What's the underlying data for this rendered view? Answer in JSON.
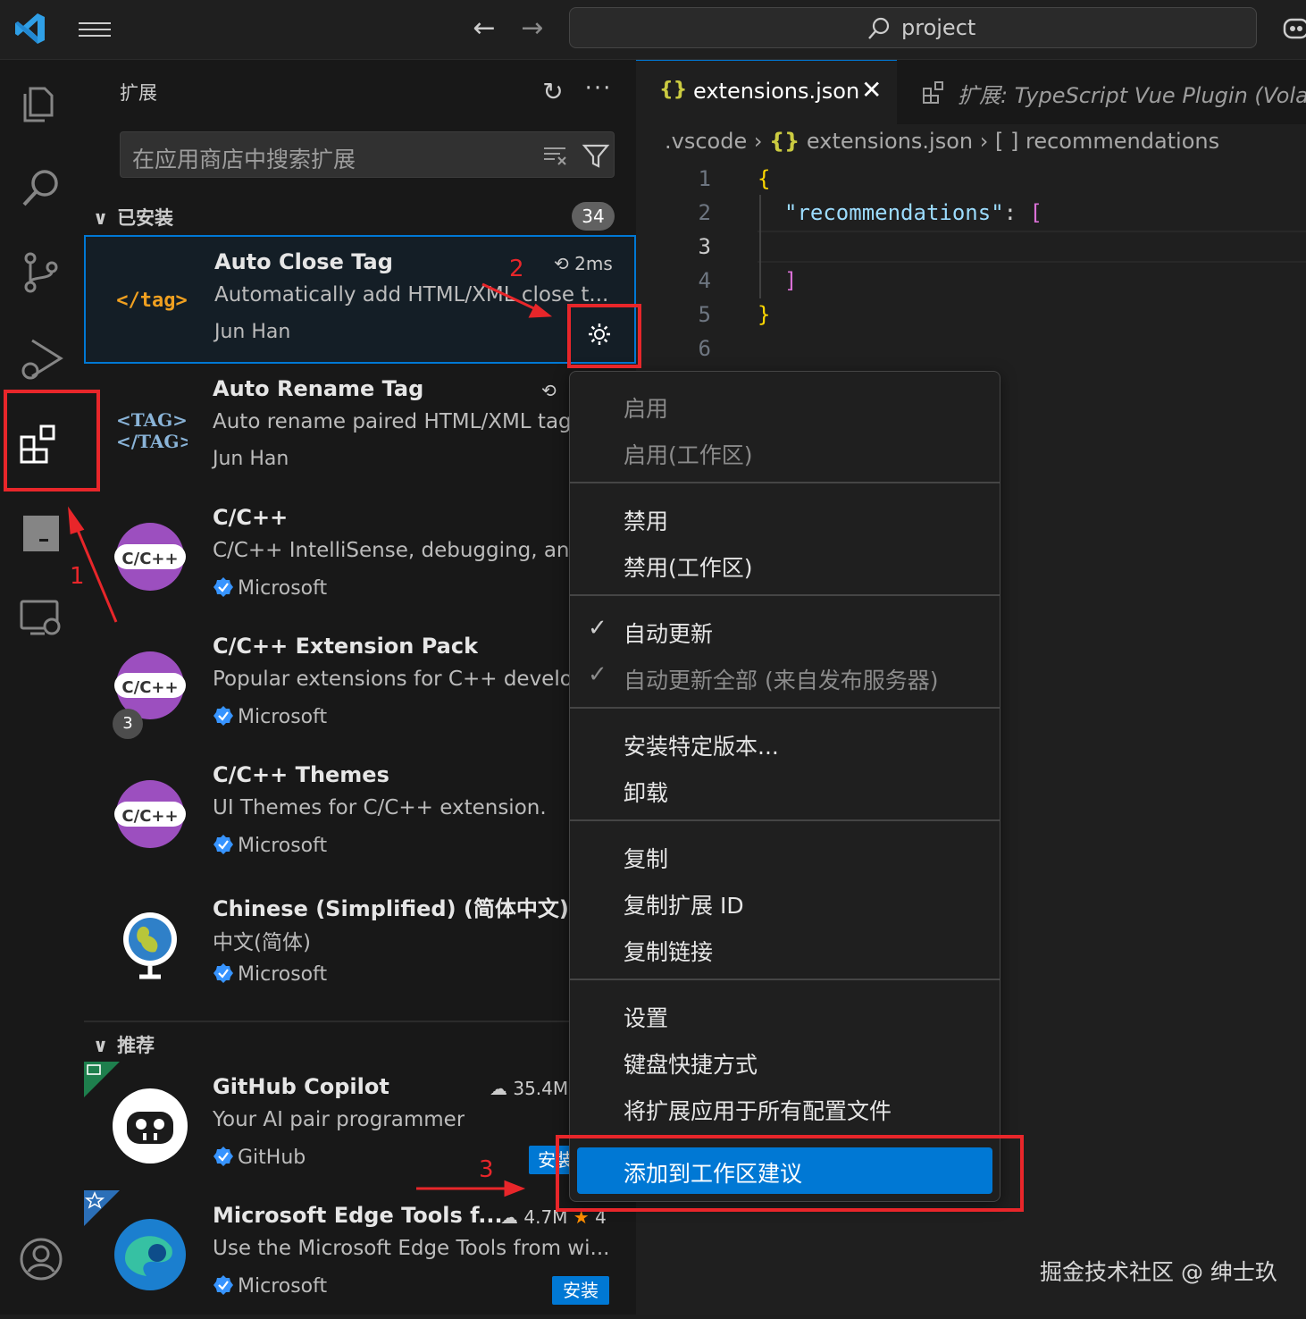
{
  "titlebar": {
    "search_text": "project",
    "icons": [
      "vscode-logo",
      "menu-icon",
      "arrow-left-icon",
      "arrow-right-icon",
      "search-icon",
      "copilot-icon"
    ]
  },
  "activity_bar": {
    "items": [
      "explorer-icon",
      "search-icon",
      "source-control-icon",
      "run-debug-icon",
      "extensions-icon",
      "panel-icon",
      "remote-explorer-icon",
      "account-icon"
    ]
  },
  "sidebar": {
    "title": "扩展",
    "search_placeholder": "在应用商店中搜索扩展",
    "installed_label": "已安装",
    "installed_count": "34",
    "recommended_label": "推荐",
    "installed": [
      {
        "name": "Auto Close Tag",
        "desc": "Automatically add HTML/XML close t...",
        "publisher": "Jun Han",
        "meta": "2ms",
        "icon_text": "</tag>"
      },
      {
        "name": "Auto Rename Tag",
        "desc": "Auto rename paired HTML/XML tag",
        "publisher": "Jun Han",
        "icon_text": "<TAG>"
      },
      {
        "name": "C/C++",
        "desc": "C/C++ IntelliSense, debugging, and",
        "publisher": "Microsoft",
        "icon_text": "C/C++"
      },
      {
        "name": "C/C++ Extension Pack",
        "desc": "Popular extensions for C++ develo",
        "publisher": "Microsoft",
        "icon_text": "C/C++",
        "pack_count": "3"
      },
      {
        "name": "C/C++ Themes",
        "desc": "UI Themes for C/C++ extension.",
        "publisher": "Microsoft",
        "icon_text": "C/C++"
      },
      {
        "name": "Chinese (Simplified) (简体中文) La",
        "desc": "中文(简体)",
        "publisher": "Microsoft"
      }
    ],
    "recommended": [
      {
        "name": "GitHub Copilot",
        "desc": "Your AI pair programmer",
        "publisher": "GitHub",
        "downloads": "35.4M",
        "install_label": "安装"
      },
      {
        "name": "Microsoft Edge Tools f...",
        "desc": "Use the Microsoft Edge Tools from wi...",
        "publisher": "Microsoft",
        "downloads": "4.7M",
        "rating": "4",
        "install_label": "安装"
      }
    ]
  },
  "editor": {
    "active_tab": "extensions.json",
    "other_tab": "扩展: TypeScript Vue Plugin (Volar)",
    "breadcrumb": {
      "folder": ".vscode",
      "file": "extensions.json",
      "symbol": "recommendations"
    },
    "line_numbers": [
      "1",
      "2",
      "3",
      "4",
      "5",
      "6"
    ],
    "code": {
      "l1": "{",
      "l2_key": "\"recommendations\"",
      "l2_colon": ": ",
      "l2_bracket": "[",
      "l4": "]",
      "l5": "}"
    }
  },
  "context_menu": {
    "items": {
      "enable": "启用",
      "enable_ws": "启用(工作区)",
      "disable": "禁用",
      "disable_ws": "禁用(工作区)",
      "auto_update": "自动更新",
      "auto_update_all": "自动更新全部 (来自发布服务器)",
      "install_version": "安装特定版本...",
      "uninstall": "卸载",
      "copy": "复制",
      "copy_id": "复制扩展 ID",
      "copy_link": "复制链接",
      "settings": "设置",
      "keybindings": "键盘快捷方式",
      "apply_all_profiles": "将扩展应用于所有配置文件",
      "add_ws_recommend": "添加到工作区建议"
    },
    "check_mark": "✓"
  },
  "annotations": {
    "n1": "1",
    "n2": "2",
    "n3": "3",
    "color": "#e8262a"
  },
  "watermark": "掘金技术社区 @ 绅士玖",
  "colors": {
    "accent": "#0078d4",
    "bg": "#1f1f1f",
    "sidebar": "#181818"
  }
}
